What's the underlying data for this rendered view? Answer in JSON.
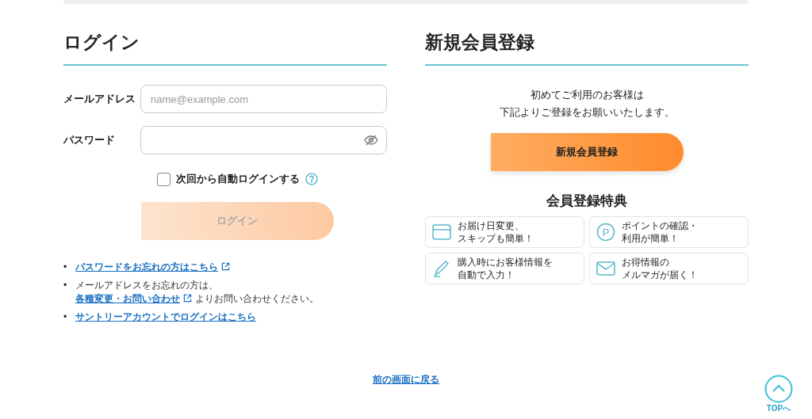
{
  "login": {
    "title": "ログイン",
    "email": {
      "label": "メールアドレス",
      "placeholder": "name@example.com"
    },
    "password": {
      "label": "パスワード"
    },
    "remember": {
      "label": "次回から自動ログインする",
      "checked": false
    },
    "button": {
      "label": "ログイン",
      "disabled": true
    },
    "links": [
      {
        "kind": "link",
        "bullet": "•",
        "text": "パスワードをお忘れの方はこちら",
        "external": true
      },
      {
        "kind": "note",
        "bullet": "•",
        "before": "メールアドレスをお忘れの方は、",
        "link": "各種変更・お問い合わせ",
        "after": "よりお問い合わせください。",
        "external": true
      },
      {
        "kind": "link",
        "bullet": "•",
        "text": "サントリーアカウントでログインはこちら",
        "external": false
      }
    ]
  },
  "register": {
    "title": "新規会員登録",
    "intro": [
      "初めてご利用のお客様は",
      "下記よりご登録をお願いいたします。"
    ],
    "button": "新規会員登録",
    "benefits_title": "会員登録特典",
    "benefits": [
      {
        "kind": "calendar",
        "lines": [
          "お届け日変更、",
          "スキップも簡単！"
        ]
      },
      {
        "kind": "point",
        "icon_label": "P",
        "lines": [
          "ポイントの確認・",
          "利用が簡単！"
        ]
      },
      {
        "kind": "pen",
        "lines": [
          "購入時にお客様情報を",
          "自動で入力！"
        ]
      },
      {
        "kind": "mail",
        "lines": [
          "お得情報の",
          "メルマガが届く！"
        ]
      }
    ]
  },
  "back_link": "前の画面に戻る",
  "top_button": "TOPへ"
}
